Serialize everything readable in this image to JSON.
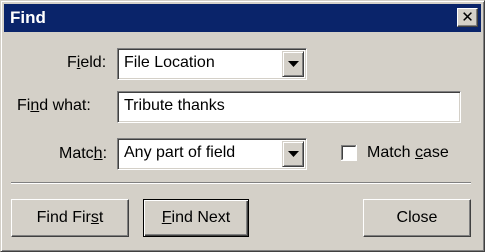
{
  "window": {
    "title": "Find",
    "close_glyph": "✕"
  },
  "form": {
    "field": {
      "label_pre": "F",
      "label_u": "i",
      "label_post": "eld:",
      "value": "File Location"
    },
    "find_what": {
      "label_pre": "Fi",
      "label_u": "n",
      "label_post": "d what:",
      "value": "Tribute thanks"
    },
    "match": {
      "label_pre": "Matc",
      "label_u": "h",
      "label_post": ":",
      "value": "Any part of field"
    },
    "match_case": {
      "label_pre": "Match ",
      "label_u": "c",
      "label_post": "ase",
      "checked": false
    }
  },
  "buttons": {
    "find_first": {
      "pre": "Find Fir",
      "u": "s",
      "post": "t"
    },
    "find_next": {
      "pre": "",
      "u": "F",
      "post": "ind Next"
    },
    "close": {
      "label": "Close"
    }
  },
  "icons": {
    "dropdown": "chevron-down-icon",
    "close": "close-icon",
    "checkbox": "checkbox-icon"
  },
  "colors": {
    "titlebar": "#0a246a",
    "face": "#d4d0c8"
  }
}
